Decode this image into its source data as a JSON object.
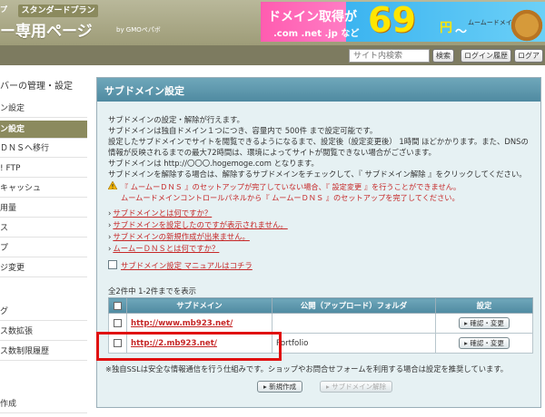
{
  "header": {
    "brand_prefix": "プ",
    "plan_tag": "スタンダードプラン",
    "title": "ー専用ページ",
    "by": "by GMOペパボ"
  },
  "ad": {
    "line1": "ドメイン取得が",
    "line2": ".com .net .jp など",
    "price": "69",
    "yen": "円",
    "tilde": "〜",
    "brand": "ムームードメイン"
  },
  "searchbar": {
    "placeholder": "サイト内検索",
    "search_btn": "検索",
    "login_history": "ログイン履歴",
    "logout": "ログア"
  },
  "sidebar": {
    "section_title": "バーの管理・設定",
    "items": [
      {
        "label": "ン設定"
      },
      {
        "label": "ン設定"
      },
      {
        "label": "ＤＮＳへ移行"
      },
      {
        "label": "! FTP"
      },
      {
        "label": "キャッシュ"
      },
      {
        "label": "用量"
      },
      {
        "label": "ス"
      },
      {
        "label": "プ"
      },
      {
        "label": "ジ変更"
      },
      {
        "label": "グ"
      },
      {
        "label": "ス数拡張"
      },
      {
        "label": "ス数制限履歴"
      },
      {
        "label": "作成"
      }
    ]
  },
  "panel": {
    "title": "サブドメイン設定",
    "desc": [
      "サブドメインの設定・解除が行えます。",
      "サブドメインは独自ドメイン１つにつき、容量内で 500件 まで設定可能です。",
      "設定したサブドメインでサイトを閲覧できるようになるまで、設定後（設定変更後） 1時間 ほどかかります。また、DNSの",
      "情報が反映されるまでの最大72時間は、環境によってサイトが閲覧できない場合がございます。",
      "サブドメインは http://〇〇〇.hogemoge.com となります。",
      "サブドメインを解除する場合は、解除するサブドメインをチェックして、『 サブドメイン解除 』をクリックしてください。"
    ],
    "warnings": [
      "『 ムームーＤＮＳ 』のセットアップが完了していない場合、『 設定変更 』を行うことができません。",
      "ムームードメインコントロールパネルから『 ムームーＤＮＳ 』のセットアップを完了してください。"
    ],
    "help_links": [
      "サブドメインとは何ですか？",
      "サブドメインを設定したのですが表示されません。",
      "サブドメインの新規作成が出来ません。",
      "ムームーＤＮＳとは何ですか？"
    ],
    "manual_link": "サブドメイン設定 マニュアルはコチラ",
    "count": "全2件中 1-2件までを表示",
    "table": {
      "headers": [
        "",
        "サブドメイン",
        "公開（アップロード）フォルダ",
        "設定"
      ],
      "rows": [
        {
          "subdomain": "http://www.mb923.net/",
          "folder": "",
          "action": "確認・変更"
        },
        {
          "subdomain": "http://2.mb923.net/",
          "folder": "Portfolio",
          "action": "確認・変更"
        }
      ]
    },
    "note": "※独自SSLは安全な情報通信を行う仕組みです。ショップやお問合せフォームを利用する場合は設定を推奨しています。",
    "new_button": "新規作成",
    "remove_button": "サブドメイン解除"
  },
  "colors": {
    "header_bg": "#9e9c78",
    "panel_head": "#4f8aa1",
    "link_red": "#c62828",
    "highlight": "#e01010"
  }
}
